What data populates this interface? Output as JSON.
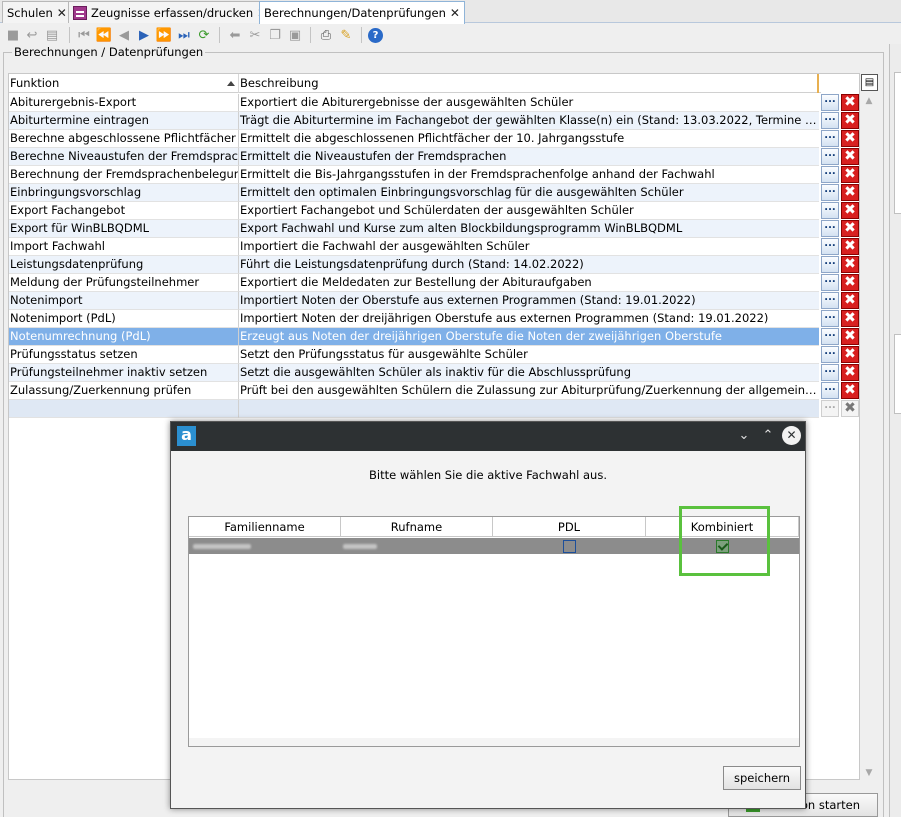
{
  "tabs": [
    {
      "label": "Schulen",
      "close": "✕"
    },
    {
      "label": "Zeugnisse erfassen/drucken",
      "close": "✕"
    },
    {
      "label": "Berechnungen/Datenprüfungen",
      "close": "✕"
    }
  ],
  "toolbar": {
    "icons": [
      "save-icon",
      "undo-icon",
      "record-icon",
      "first-icon",
      "rewind-icon",
      "prev-icon",
      "next-icon",
      "fast-forward-icon",
      "last-icon",
      "refresh-icon",
      "back-arrow-icon",
      "cut-icon",
      "copy-icon",
      "paste-icon",
      "print-icon",
      "clear-icon",
      "help-icon"
    ]
  },
  "group": {
    "title": "Berechnungen / Datenprüfungen"
  },
  "table": {
    "columns": {
      "funktion": "Funktion",
      "beschreibung": "Beschreibung"
    },
    "sort": "ascending",
    "dots_label": "...",
    "delete_label": "✖",
    "rows": [
      {
        "funktion": "Abiturergebnis-Export",
        "beschreibung": "Exportiert die Abiturergebnisse der ausgewählten Schüler"
      },
      {
        "funktion": "Abiturtermine eintragen",
        "beschreibung": "Trägt die Abiturtermine im Fachangebot der gewählten Klasse(n) ein (Stand: 13.03.2022, Termine für Abiturja..."
      },
      {
        "funktion": "Berechne abgeschlossene Pflichtfächer",
        "beschreibung": "Ermittelt die abgeschlossenen Pflichtfächer der 10. Jahrgangsstufe"
      },
      {
        "funktion": "Berechne Niveaustufen der Fremdsprachen",
        "beschreibung": "Ermittelt die Niveaustufen der Fremdsprachen"
      },
      {
        "funktion": "Berechnung der Fremdsprachenbelegung",
        "beschreibung": "Ermittelt die Bis-Jahrgangsstufen in der Fremdsprachenfolge anhand der Fachwahl"
      },
      {
        "funktion": "Einbringungsvorschlag",
        "beschreibung": "Ermittelt den optimalen Einbringungsvorschlag für die ausgewählten Schüler"
      },
      {
        "funktion": "Export Fachangebot",
        "beschreibung": "Exportiert Fachangebot und Schülerdaten der ausgewählten Schüler"
      },
      {
        "funktion": "Export für WinBLBQDML",
        "beschreibung": "Export Fachwahl und Kurse zum alten Blockbildungsprogramm WinBLBQDML"
      },
      {
        "funktion": "Import Fachwahl",
        "beschreibung": "Importiert die Fachwahl der ausgewählten Schüler"
      },
      {
        "funktion": "Leistungsdatenprüfung",
        "beschreibung": "Führt die Leistungsdatenprüfung durch (Stand: 14.02.2022)"
      },
      {
        "funktion": "Meldung der Prüfungsteilnehmer",
        "beschreibung": "Exportiert die Meldedaten zur Bestellung der Abituraufgaben"
      },
      {
        "funktion": "Notenimport",
        "beschreibung": "Importiert Noten der Oberstufe aus externen Programmen (Stand: 19.01.2022)"
      },
      {
        "funktion": "Notenimport (PdL)",
        "beschreibung": "Importiert Noten der dreijährigen Oberstufe aus externen Programmen (Stand: 19.01.2022)"
      },
      {
        "funktion": "Notenumrechnung (PdL)",
        "beschreibung": "Erzeugt aus Noten der dreijährigen Oberstufe die Noten der zweijährigen Oberstufe",
        "selected": true
      },
      {
        "funktion": "Prüfungsstatus setzen",
        "beschreibung": "Setzt den Prüfungsstatus für ausgewählte Schüler"
      },
      {
        "funktion": "Prüfungsteilnehmer inaktiv setzen",
        "beschreibung": "Setzt die ausgewählten Schüler als inaktiv für die Abschlussprüfung"
      },
      {
        "funktion": "Zulassung/Zuerkennung prüfen",
        "beschreibung": "Prüft bei den ausgewählten Schülern die Zulassung zur Abiturprüfung/Zuerkennung der allgemeinen Hochs..."
      },
      {
        "funktion": "",
        "beschreibung": "",
        "empty": true
      }
    ]
  },
  "start_button": {
    "label": "Funktion starten"
  },
  "dialog": {
    "logo": "a",
    "prompt": "Bitte wählen Sie die aktive Fachwahl aus.",
    "columns": [
      "Familienname",
      "Rufname",
      "PDL",
      "Kombiniert"
    ],
    "rows": [
      {
        "familienname": "",
        "rufname": "",
        "pdl": false,
        "kombiniert": true
      }
    ],
    "save_label": "speichern",
    "highlight_color": "#5ac13e"
  },
  "colors": {
    "selection": "#7fb0e8",
    "alt_row": "#edf3fb",
    "delete": "#d82020",
    "titlebar": "#2d3133"
  }
}
